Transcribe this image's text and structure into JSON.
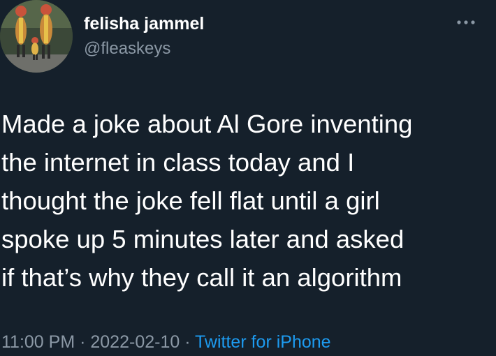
{
  "author": {
    "display_name": "felisha jammel",
    "handle": "@fleaskeys"
  },
  "tweet": {
    "lines": [
      "Made a joke about Al Gore inventing",
      "the internet in class today and I",
      "thought the joke fell flat until a girl",
      "spoke up 5 minutes later and asked",
      "if that’s why they call it an algorithm"
    ]
  },
  "meta": {
    "time": "11:00 PM",
    "separator": " · ",
    "date": "2022-02-10",
    "source": "Twitter for iPhone"
  },
  "icons": {
    "more": "more-horizontal-icon"
  },
  "colors": {
    "background": "#15202b",
    "text": "#ffffff",
    "secondary_text": "#8b98a5",
    "link": "#1d9bf0"
  }
}
